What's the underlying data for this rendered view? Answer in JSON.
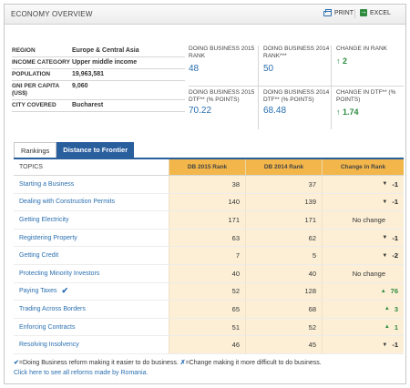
{
  "header": {
    "title": "ECONOMY OVERVIEW",
    "print_label": "PRINT",
    "excel_label": "EXCEL"
  },
  "info": [
    {
      "key": "REGION",
      "value": "Europe & Central Asia"
    },
    {
      "key": "INCOME CATEGORY",
      "value": "Upper middle income"
    },
    {
      "key": "POPULATION",
      "value": "19,963,581"
    },
    {
      "key": "GNI PER CAPITA (US$)",
      "value": "9,060"
    },
    {
      "key": "CITY COVERED",
      "value": "Bucharest"
    }
  ],
  "metrics": {
    "db2015_rank": {
      "label": "DOING BUSINESS 2015 RANK",
      "value": "48"
    },
    "db2014_rank": {
      "label": "DOING BUSINESS 2014 RANK***",
      "value": "50"
    },
    "change_rank": {
      "label": "CHANGE IN RANK",
      "value": "2"
    },
    "db2015_dtf": {
      "label": "DOING BUSINESS 2015 DTF** (% POINTS)",
      "value": "70.22"
    },
    "db2014_dtf": {
      "label": "DOING BUSINESS 2014 DTF** (% POINTS)",
      "value": "68.48"
    },
    "change_dtf": {
      "label": "CHANGE IN DTF** (% POINTS)",
      "value": "1.74"
    }
  },
  "tabs": [
    "Rankings",
    "Distance to Frontier"
  ],
  "table": {
    "headers": [
      "TOPICS",
      "DB 2015 Rank",
      "DB 2014 Rank",
      "Change in Rank"
    ],
    "rows": [
      {
        "topic": "Starting a Business",
        "db2015": "38",
        "db2014": "37",
        "change": "-1",
        "dir": "down",
        "reform": false
      },
      {
        "topic": "Dealing with Construction Permits",
        "db2015": "140",
        "db2014": "139",
        "change": "-1",
        "dir": "down",
        "reform": false
      },
      {
        "topic": "Getting Electricity",
        "db2015": "171",
        "db2014": "171",
        "change": "No change",
        "dir": "none",
        "reform": false
      },
      {
        "topic": "Registering Property",
        "db2015": "63",
        "db2014": "62",
        "change": "-1",
        "dir": "down",
        "reform": false
      },
      {
        "topic": "Getting Credit",
        "db2015": "7",
        "db2014": "5",
        "change": "-2",
        "dir": "down",
        "reform": false
      },
      {
        "topic": "Protecting Minority Investors",
        "db2015": "40",
        "db2014": "40",
        "change": "No change",
        "dir": "none",
        "reform": false
      },
      {
        "topic": "Paying Taxes",
        "db2015": "52",
        "db2014": "128",
        "change": "76",
        "dir": "up",
        "reform": true
      },
      {
        "topic": "Trading Across Borders",
        "db2015": "65",
        "db2014": "68",
        "change": "3",
        "dir": "up",
        "reform": false
      },
      {
        "topic": "Enforcing Contracts",
        "db2015": "51",
        "db2014": "52",
        "change": "1",
        "dir": "up",
        "reform": false
      },
      {
        "topic": "Resolving Insolvency",
        "db2015": "46",
        "db2014": "45",
        "change": "-1",
        "dir": "down",
        "reform": false
      }
    ]
  },
  "footnote": {
    "check_text": "=Doing Business reform making it easier to do business.",
    "cross_text": "=Change making it more difficult to do business.",
    "link_text": "Click here to see all reforms made by Romania."
  },
  "colors": {
    "accent_blue": "#2a6fb0",
    "tab_blue": "#2a5f9e",
    "header_orange": "#f3b64a",
    "cell_peach": "#fcefd6",
    "up_green": "#2e8b3e"
  }
}
